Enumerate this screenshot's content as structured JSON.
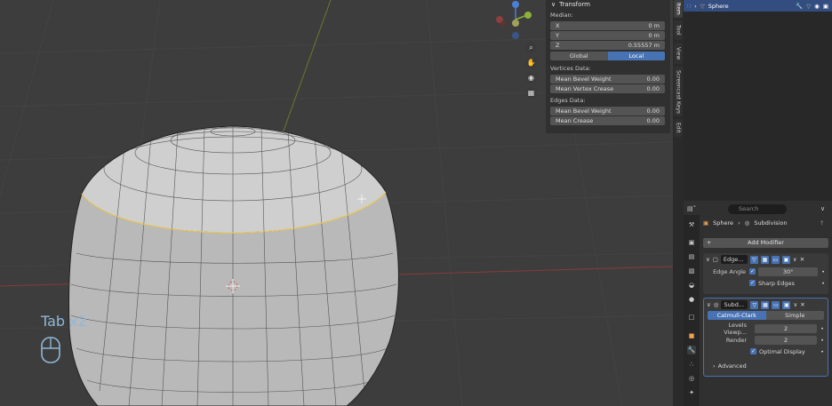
{
  "npanel": {
    "title": "Transform",
    "median_label": "Median:",
    "x_label": "X",
    "x_value": "0 m",
    "y_label": "Y",
    "y_value": "0 m",
    "z_label": "Z",
    "z_value": "0.55557 m",
    "orient_global": "Global",
    "orient_local": "Local",
    "vertices_label": "Vertices Data:",
    "mean_bevel_weight_v_label": "Mean Bevel Weight",
    "mean_bevel_weight_v": "0.00",
    "mean_vertex_crease_label": "Mean Vertex Crease",
    "mean_vertex_crease": "0.00",
    "edges_label": "Edges Data:",
    "mean_bevel_weight_e_label": "Mean Bevel Weight",
    "mean_bevel_weight_e": "0.00",
    "mean_crease_label": "Mean Crease",
    "mean_crease": "0.00"
  },
  "tabs": [
    "Item",
    "Tool",
    "View",
    "Screencast Keys",
    "Edit"
  ],
  "outliner": {
    "object_name": "Sphere"
  },
  "properties": {
    "search_placeholder": "Search",
    "breadcrumb_object": "Sphere",
    "breadcrumb_modifier": "Subdivision",
    "add_modifier": "Add Modifier",
    "mod1": {
      "name": "Edge...",
      "edge_angle_label": "Edge Angle",
      "edge_angle_value": "30°",
      "sharp_edges_label": "Sharp Edges"
    },
    "mod2": {
      "name": "Subd...",
      "catmull": "Catmull-Clark",
      "simple": "Simple",
      "levels_label": "Levels Viewp...",
      "levels_value": "2",
      "render_label": "Render",
      "render_value": "2",
      "optimal_label": "Optimal Display",
      "advanced_label": "Advanced"
    }
  },
  "overlay": {
    "keys_text": "Tab x2"
  },
  "colors": {
    "accent": "#4772b3",
    "selection": "#e8c75a",
    "background": "#3d3d3d"
  }
}
